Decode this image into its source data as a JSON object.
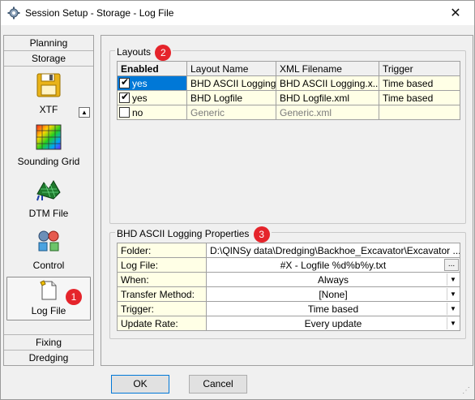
{
  "window": {
    "title": "Session Setup - Storage -  Log File",
    "close_glyph": "✕"
  },
  "nav": {
    "top_tabs": [
      "Planning",
      "Storage"
    ],
    "items": [
      {
        "label": "XTF",
        "icon": "floppy-disk-icon"
      },
      {
        "label": "Sounding Grid",
        "icon": "sounding-grid-icon"
      },
      {
        "label": "DTM File",
        "icon": "dtm-file-icon"
      },
      {
        "label": "Control",
        "icon": "control-icon"
      },
      {
        "label": "Log File",
        "icon": "log-file-icon",
        "selected": true,
        "badge": "1"
      }
    ],
    "bottom_tabs": [
      "Fixing",
      "Dredging"
    ]
  },
  "layouts": {
    "caption": "Layouts",
    "badge": "2",
    "columns": [
      "Enabled",
      "Layout Name",
      "XML Filename",
      "Trigger"
    ],
    "rows": [
      {
        "checked": true,
        "enabled": "yes",
        "name": "BHD ASCII Logging",
        "xml": "BHD ASCII Logging.x...",
        "trigger": "Time based"
      },
      {
        "checked": true,
        "enabled": "yes",
        "name": "BHD Logfile",
        "xml": "BHD Logfile.xml",
        "trigger": "Time based"
      },
      {
        "checked": false,
        "enabled": "no",
        "name": "Generic",
        "xml": "Generic.xml",
        "trigger": ""
      }
    ]
  },
  "properties": {
    "caption": "BHD ASCII Logging Properties",
    "badge": "3",
    "rows": [
      {
        "key": "Folder:",
        "value": "D:\\QINSy data\\Dredging\\Backhoe_Excavator\\Excavator ..."
      },
      {
        "key": "Log File:",
        "value": "#X - Logfile %d%b%y.txt",
        "ellipsis": "..."
      },
      {
        "key": "When:",
        "value": "Always"
      },
      {
        "key": "Transfer Method:",
        "value": "[None]"
      },
      {
        "key": "Trigger:",
        "value": "Time based"
      },
      {
        "key": "Update Rate:",
        "value": "Every update"
      }
    ]
  },
  "buttons": {
    "ok": "OK",
    "cancel": "Cancel"
  }
}
